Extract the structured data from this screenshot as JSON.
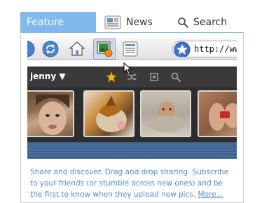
{
  "tabs": {
    "feature": "Feature",
    "news": "News",
    "search": "Search"
  },
  "browser": {
    "url": "http://www.wild"
  },
  "toolbar": {
    "user": "jenny ▼"
  },
  "description": {
    "text": "Share and discover. Drag and drop sharing. Subscribe to your friends (or stumble across new ones) and be the first to know when they upload new pics.",
    "more": "More..."
  },
  "colors": {
    "accent": "#7fb9ee",
    "link": "#4d8fd1",
    "dark_bar": "#3a3a3a",
    "band": "#3d5f8c"
  },
  "icons": [
    "newspaper-icon",
    "search-icon",
    "refresh-icon",
    "home-icon",
    "photo-icon",
    "feed-icon",
    "star-badge-icon",
    "star-icon",
    "shuffle-icon",
    "fullscreen-icon",
    "magnifier-icon",
    "cursor-icon"
  ]
}
